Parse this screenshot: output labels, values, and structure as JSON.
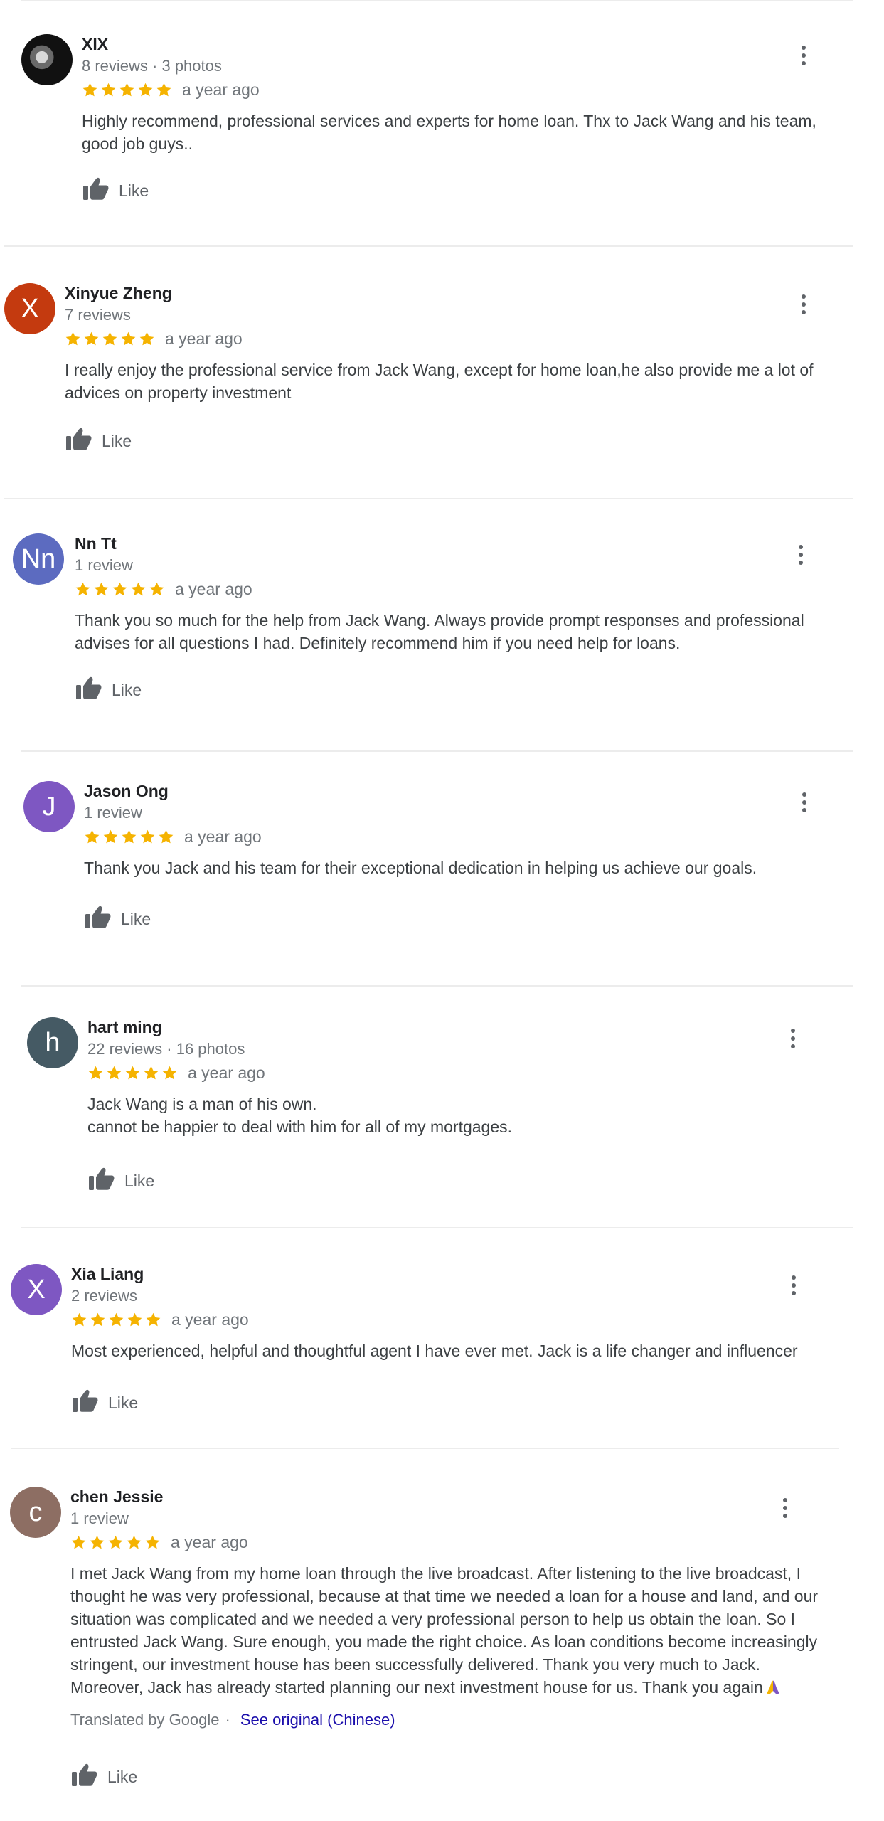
{
  "star_color": "#f5b301",
  "reviews": [
    {
      "name": "XIX",
      "meta": "8 reviews · 3 photos",
      "rating": 5,
      "date": "a year ago",
      "text": "Highly recommend, professional services and  experts for home loan. Thx to Jack Wang and his team,\ngood job guys..",
      "like_label": "Like",
      "avatar": {
        "type": "photo",
        "letter": "",
        "color": "#111111"
      }
    },
    {
      "name": "Xinyue Zheng",
      "meta": "7 reviews",
      "rating": 5,
      "date": "a year ago",
      "text": "I really enjoy the professional service from Jack Wang,  except for home loan,he also provide me a lot of\nadvices on property investment",
      "like_label": "Like",
      "avatar": {
        "type": "letter",
        "letter": "X",
        "color": "#c43a0f"
      }
    },
    {
      "name": "Nn Tt",
      "meta": "1 review",
      "rating": 5,
      "date": "a year ago",
      "text": "Thank you so much for the help from Jack Wang. Always provide prompt responses and professional\nadvises for all questions I had. Definitely recommend him if you need help for loans.",
      "like_label": "Like",
      "avatar": {
        "type": "letter",
        "letter": "Nn",
        "color": "#5c6bc0"
      }
    },
    {
      "name": "Jason Ong",
      "meta": "1 review",
      "rating": 5,
      "date": "a year ago",
      "text": "Thank you Jack and his team for their exceptional dedication in helping us achieve our goals.",
      "like_label": "Like",
      "avatar": {
        "type": "letter",
        "letter": "J",
        "color": "#7e57c2"
      }
    },
    {
      "name": "hart ming",
      "meta": "22 reviews · 16 photos",
      "rating": 5,
      "date": "a year ago",
      "text": "Jack Wang is a man of his own.\ncannot be happier to deal with him for all of my mortgages.",
      "like_label": "Like",
      "avatar": {
        "type": "letter",
        "letter": "h",
        "color": "#455a64"
      }
    },
    {
      "name": "Xia Liang",
      "meta": "2 reviews",
      "rating": 5,
      "date": "a year ago",
      "text": "Most experienced, helpful and thoughtful agent I have ever met. Jack is a life changer and influencer",
      "like_label": "Like",
      "avatar": {
        "type": "letter",
        "letter": "X",
        "color": "#7e57c2"
      }
    },
    {
      "name": "chen Jessie",
      "meta": "1 review",
      "rating": 5,
      "date": "a year ago",
      "text": "I met Jack Wang from my home loan through the live broadcast. After listening to the live broadcast, I\nthought he was very professional, because at that time we needed a loan for a house and land, and our\nsituation was complicated and we needed a very professional person to help us obtain the loan. So I\nentrusted Jack Wang. Sure enough, you made the right choice. As loan conditions become increasingly\nstringent, our investment house has been successfully delivered. Thank you very much to Jack.\nMoreover, Jack has already started planning our next investment house for us. Thank you again",
      "text_emoji": "folded-hands-icon",
      "translated_label": "Translated by Google",
      "see_original_label": "See original (Chinese)",
      "like_label": "Like",
      "avatar": {
        "type": "letter",
        "letter": "c",
        "color": "#8d6e63"
      }
    }
  ]
}
